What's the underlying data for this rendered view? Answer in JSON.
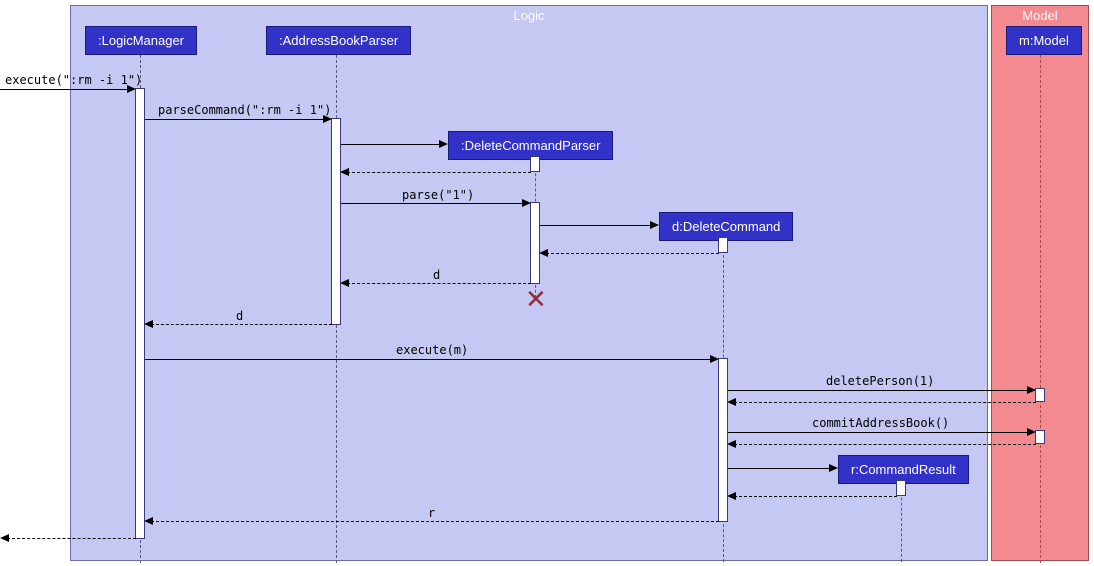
{
  "frames": {
    "logic": "Logic",
    "model": "Model"
  },
  "participants": {
    "logicManager": ":LogicManager",
    "addressBookParser": ":AddressBookParser",
    "deleteCommandParser": ":DeleteCommandParser",
    "deleteCommand": "d:DeleteCommand",
    "commandResult": "r:CommandResult",
    "model": "m:Model"
  },
  "messages": {
    "m1": "execute(\":rm -i 1\")",
    "m2": "parseCommand(\":rm -i 1\")",
    "m3": "parse(\"1\")",
    "m4": "d",
    "m5": "d",
    "m6": "execute(m)",
    "m7": "deletePerson(1)",
    "m8": "commitAddressBook()",
    "m9": "r"
  },
  "chart_data": {
    "type": "uml-sequence",
    "frames": [
      {
        "name": "Logic",
        "contains": [
          ":LogicManager",
          ":AddressBookParser",
          ":DeleteCommandParser",
          "d:DeleteCommand",
          "r:CommandResult"
        ]
      },
      {
        "name": "Model",
        "contains": [
          "m:Model"
        ]
      }
    ],
    "lifelines": [
      ":LogicManager",
      ":AddressBookParser",
      ":DeleteCommandParser",
      "d:DeleteCommand",
      "r:CommandResult",
      "m:Model"
    ],
    "interactions": [
      {
        "from": "external",
        "to": ":LogicManager",
        "label": "execute(\":rm -i 1\")",
        "kind": "sync"
      },
      {
        "from": ":LogicManager",
        "to": ":AddressBookParser",
        "label": "parseCommand(\":rm -i 1\")",
        "kind": "sync"
      },
      {
        "from": ":AddressBookParser",
        "to": ":DeleteCommandParser",
        "label": "",
        "kind": "create"
      },
      {
        "from": ":DeleteCommandParser",
        "to": ":AddressBookParser",
        "label": "",
        "kind": "return"
      },
      {
        "from": ":AddressBookParser",
        "to": ":DeleteCommandParser",
        "label": "parse(\"1\")",
        "kind": "sync"
      },
      {
        "from": ":DeleteCommandParser",
        "to": "d:DeleteCommand",
        "label": "",
        "kind": "create"
      },
      {
        "from": "d:DeleteCommand",
        "to": ":DeleteCommandParser",
        "label": "",
        "kind": "return"
      },
      {
        "from": ":DeleteCommandParser",
        "to": ":AddressBookParser",
        "label": "d",
        "kind": "return"
      },
      {
        "from": ":DeleteCommandParser",
        "to": ":DeleteCommandParser",
        "label": "",
        "kind": "destroy"
      },
      {
        "from": ":AddressBookParser",
        "to": ":LogicManager",
        "label": "d",
        "kind": "return"
      },
      {
        "from": ":LogicManager",
        "to": "d:DeleteCommand",
        "label": "execute(m)",
        "kind": "sync"
      },
      {
        "from": "d:DeleteCommand",
        "to": "m:Model",
        "label": "deletePerson(1)",
        "kind": "sync"
      },
      {
        "from": "m:Model",
        "to": "d:DeleteCommand",
        "label": "",
        "kind": "return"
      },
      {
        "from": "d:DeleteCommand",
        "to": "m:Model",
        "label": "commitAddressBook()",
        "kind": "sync"
      },
      {
        "from": "m:Model",
        "to": "d:DeleteCommand",
        "label": "",
        "kind": "return"
      },
      {
        "from": "d:DeleteCommand",
        "to": "r:CommandResult",
        "label": "",
        "kind": "create"
      },
      {
        "from": "r:CommandResult",
        "to": "d:DeleteCommand",
        "label": "",
        "kind": "return"
      },
      {
        "from": "d:DeleteCommand",
        "to": ":LogicManager",
        "label": "r",
        "kind": "return"
      },
      {
        "from": ":LogicManager",
        "to": "external",
        "label": "",
        "kind": "return"
      }
    ]
  }
}
